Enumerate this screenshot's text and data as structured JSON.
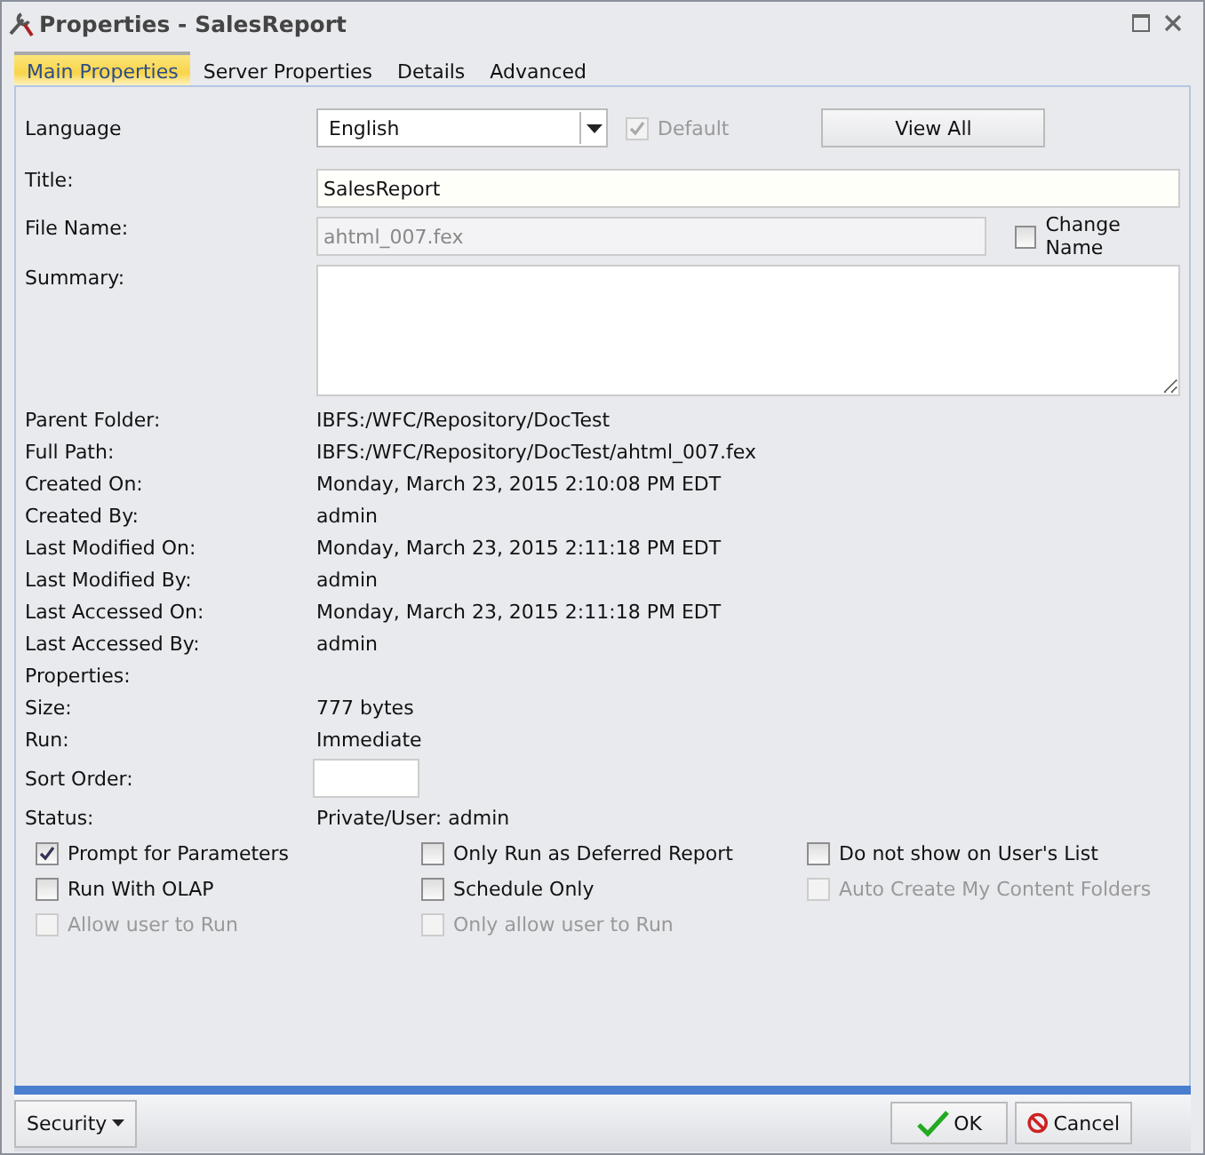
{
  "window": {
    "title": "Properties - SalesReport"
  },
  "tabs": [
    {
      "label": "Main Properties",
      "selected": true
    },
    {
      "label": "Server Properties",
      "selected": false
    },
    {
      "label": "Details",
      "selected": false
    },
    {
      "label": "Advanced",
      "selected": false
    }
  ],
  "language": {
    "label": "Language",
    "value": "English",
    "default": {
      "label": "Default",
      "checked": true,
      "disabled": true
    },
    "view_all": "View All"
  },
  "title_field": {
    "label": "Title:",
    "value": "SalesReport"
  },
  "file_name": {
    "label": "File Name:",
    "value": "ahtml_007.fex",
    "disabled": true
  },
  "change_name": {
    "label": "Change Name",
    "checked": false,
    "disabled": false
  },
  "summary": {
    "label": "Summary:"
  },
  "info": [
    {
      "kind": "text",
      "label": "Parent Folder:",
      "value": "IBFS:/WFC/Repository/DocTest"
    },
    {
      "kind": "text",
      "label": "Full Path:",
      "value": "IBFS:/WFC/Repository/DocTest/ahtml_007.fex"
    },
    {
      "kind": "text",
      "label": "Created On:",
      "value": "Monday, March 23, 2015 2:10:08 PM EDT"
    },
    {
      "kind": "text",
      "label": "Created By:",
      "value": "admin"
    },
    {
      "kind": "text",
      "label": "Last Modified On:",
      "value": "Monday, March 23, 2015 2:11:18 PM EDT"
    },
    {
      "kind": "text",
      "label": "Last Modified By:",
      "value": "admin"
    },
    {
      "kind": "text",
      "label": "Last Accessed On:",
      "value": "Monday, March 23, 2015 2:11:18 PM EDT"
    },
    {
      "kind": "text",
      "label": "Last Accessed By:",
      "value": "admin"
    },
    {
      "kind": "text",
      "label": "Properties:"
    },
    {
      "kind": "text",
      "label": "Size:",
      "value": "777 bytes"
    },
    {
      "kind": "text",
      "label": "Run:",
      "value": "Immediate"
    },
    {
      "kind": "field",
      "label": "Sort Order:"
    },
    {
      "kind": "text",
      "label": "Status:",
      "value": "Private/User: admin"
    }
  ],
  "options": [
    {
      "label": "Prompt for Parameters",
      "checked": true,
      "disabled": false
    },
    {
      "label": "Only Run as Deferred Report",
      "checked": false,
      "disabled": false
    },
    {
      "label": "Do not show on User's List",
      "checked": false,
      "disabled": false
    },
    {
      "label": "Run With OLAP",
      "checked": false,
      "disabled": false
    },
    {
      "label": "Schedule Only",
      "checked": false,
      "disabled": false
    },
    {
      "label": "Auto Create My Content Folders",
      "checked": false,
      "disabled": true
    },
    {
      "label": "Allow user to Run",
      "checked": false,
      "disabled": true
    },
    {
      "label": "Only allow user to Run",
      "checked": false,
      "disabled": true
    }
  ],
  "footer": {
    "security": "Security",
    "ok": "OK",
    "cancel": "Cancel"
  }
}
